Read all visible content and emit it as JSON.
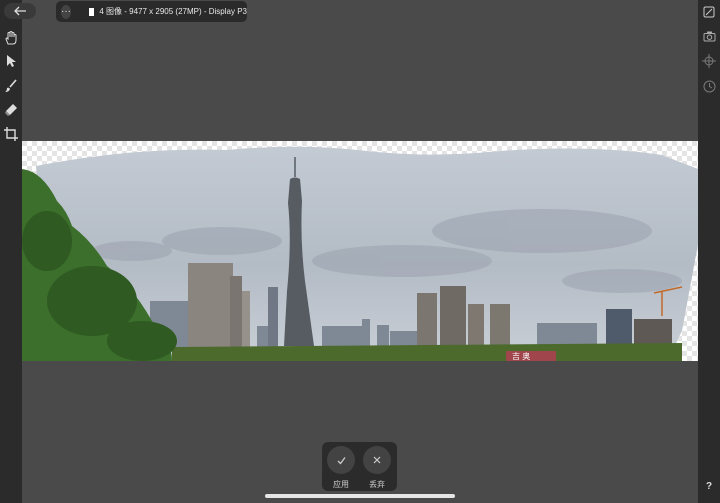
{
  "topbar": {
    "back_icon": "back-arrow-icon",
    "more_icon": "more-icon",
    "document_info": "4 图像 - 9477 x 2905 (27MP) - Display P3"
  },
  "left_tools": [
    {
      "name": "hand-tool",
      "icon": "hand-icon"
    },
    {
      "name": "move-tool",
      "icon": "pointer-arrow-icon"
    },
    {
      "name": "brush-tool",
      "icon": "brush-icon"
    },
    {
      "name": "eraser-tool",
      "icon": "eraser-icon"
    },
    {
      "name": "crop-tool",
      "icon": "crop-icon"
    }
  ],
  "right_tools": [
    {
      "name": "edit-tool",
      "icon": "edit-square-icon"
    },
    {
      "name": "camera-tool",
      "icon": "camera-icon"
    },
    {
      "name": "crosshair-tool",
      "icon": "crosshair-icon"
    },
    {
      "name": "history-tool",
      "icon": "clock-icon"
    }
  ],
  "panorama": {
    "visible_sign_text": "吉 奥"
  },
  "actions": {
    "apply_label": "应用",
    "discard_label": "丢弃",
    "apply_icon": "checkmark-icon",
    "discard_icon": "close-icon"
  },
  "help": {
    "label": "?"
  },
  "colors": {
    "app_background": "#4a4a4a",
    "toolbar": "#2b2b2b",
    "sky": "#b7bec7",
    "foliage": "#3b6f2b"
  }
}
